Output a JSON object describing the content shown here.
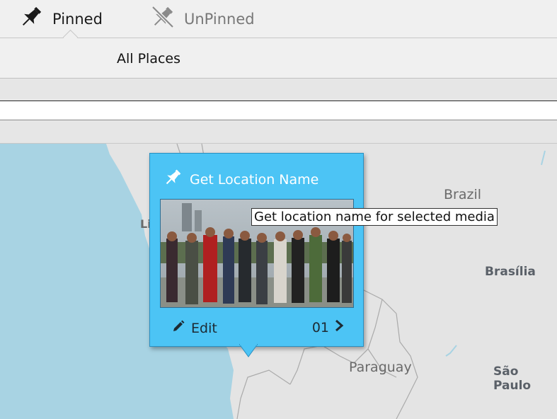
{
  "tabs": [
    {
      "label": "Pinned",
      "icon": "pin-icon",
      "selected": true
    },
    {
      "label": "UnPinned",
      "icon": "unpin-icon",
      "selected": false
    }
  ],
  "filter": {
    "label": "All Places"
  },
  "map": {
    "labels": {
      "brazil": "Brazil",
      "brasilia": "Brasília",
      "paraguay": "Paraguay",
      "sao_paulo": "São Paulo",
      "lima_partial": "Lin"
    }
  },
  "popup": {
    "title": "Get Location Name",
    "title_icon": "pin-icon",
    "edit_label": "Edit",
    "count": "01",
    "accent": "#4cc4f5"
  },
  "tooltip": {
    "text": "Get location name for selected media"
  }
}
